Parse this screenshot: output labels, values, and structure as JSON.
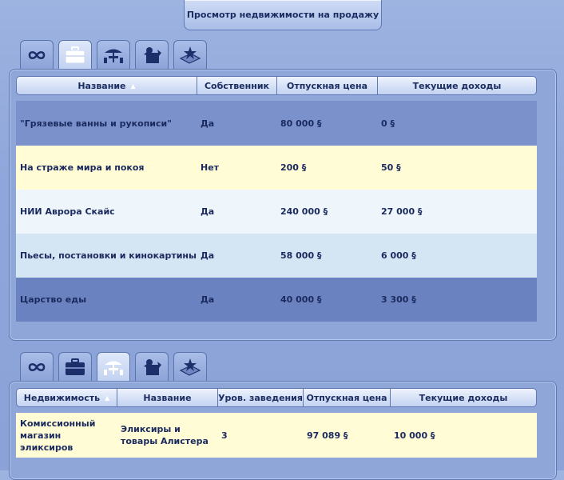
{
  "title": "Просмотр недвижимости на продажу",
  "colors": {
    "row_1": "#7a91cc",
    "row_2": "#fffcd6",
    "row_3": "#eef6fc",
    "row_4": "#d4e5f4",
    "row_5": "#6b82c0",
    "row_lower": "#fffcd6"
  },
  "tabs_icons": [
    "infinity-icon",
    "briefcase-icon",
    "cafe-table-icon",
    "character-box-icon",
    "star-plaque-icon"
  ],
  "top_panel": {
    "active_tab": 1,
    "columns": [
      "Название",
      "Собственник",
      "Отпускная цена",
      "Текущие доходы"
    ],
    "rows": [
      {
        "name": "\"Грязевые ванны и рукописи\"",
        "owner": "Да",
        "price": "80 000 §",
        "income": "0 §"
      },
      {
        "name": "На страже мира и покоя",
        "owner": "Нет",
        "price": "200 §",
        "income": "50 §"
      },
      {
        "name": "НИИ Аврора Скайс",
        "owner": "Да",
        "price": "240 000 §",
        "income": "27 000 §"
      },
      {
        "name": "Пьесы, постановки и кинокартины",
        "owner": "Да",
        "price": "58 000 §",
        "income": "6 000 §"
      },
      {
        "name": "Царство еды",
        "owner": "Да",
        "price": "40 000 §",
        "income": "3 300 §"
      }
    ]
  },
  "bottom_panel": {
    "active_tab": 2,
    "columns": [
      "Недвижимость",
      "Название",
      "Уров. заведения",
      "Отпускная цена",
      "Текущие доходы"
    ],
    "rows": [
      {
        "property": "Комиссионный магазин эликсиров",
        "name": "Эликсиры и товары Алистера",
        "level": "3",
        "price": "97 089 §",
        "income": "10 000 §"
      }
    ]
  }
}
